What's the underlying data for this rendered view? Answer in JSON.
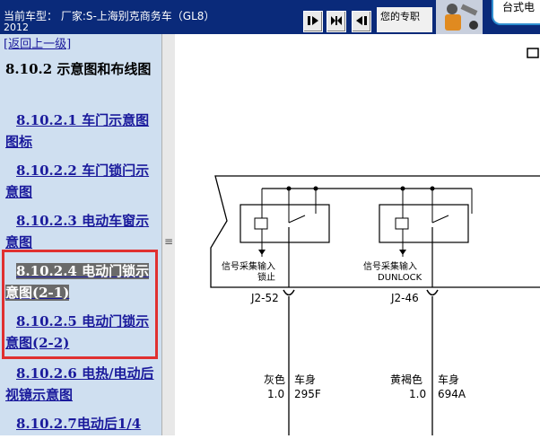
{
  "topbar": {
    "vehicle_label": "当前车型： 厂家:S-上海别克商务车（GL8）",
    "vehicle_year": "2012",
    "profile_text": "您的专职",
    "desktop_badge": "台式电"
  },
  "nav": {
    "back_link": "[返回上一级]",
    "section_title": "8.10.2 示意图和布线图",
    "items": [
      {
        "label": "8.10.2.1 车门示意图图标",
        "active": false
      },
      {
        "label": "8.10.2.2 车门锁闩示意图",
        "active": false
      },
      {
        "label": "8.10.2.3 电动车窗示意图",
        "active": false
      },
      {
        "label": "8.10.2.4 电动门锁示意图(2-1)",
        "active": true
      },
      {
        "label": "8.10.2.5 电动门锁示意图(2-2)",
        "active": false
      },
      {
        "label": "8.10.2.6 电热/电动后视镜示意图",
        "active": false
      },
      {
        "label": "8.10.2.7电动后1/4",
        "active": false
      }
    ]
  },
  "diagram": {
    "left_input_line1": "信号采集输入",
    "left_input_line2": "锁止",
    "right_input_line1": "信号采集输入",
    "right_input_line2": "DUNLOCK",
    "left_connector": "J2-52",
    "right_connector": "J2-46",
    "left_wire_color": "灰色",
    "left_wire_gauge": "1.0",
    "left_wire_dest": "车身",
    "left_wire_circuit": "295F",
    "right_wire_color": "黄褐色",
    "right_wire_gauge": "1.0",
    "right_wire_dest": "车身",
    "right_wire_circuit": "694A"
  },
  "colors": {
    "topbar_bg": "#0a2a7a",
    "panel_bg": "#cfdff0",
    "link_color": "#1a1a9c",
    "highlight_border": "#e03030"
  }
}
